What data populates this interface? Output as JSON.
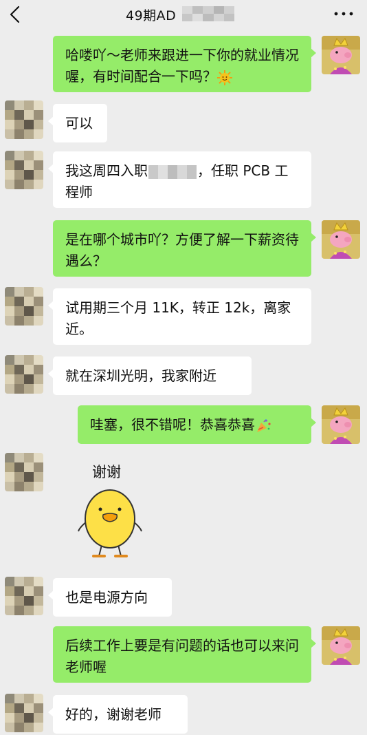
{
  "header": {
    "title_visible": "49期AD",
    "back_icon": "chevron-left-icon",
    "more_icon": "more-dots-icon"
  },
  "colors": {
    "my_bubble": "#95ec69",
    "other_bubble": "#ffffff",
    "background": "#ededed"
  },
  "messages": [
    {
      "sender": "me",
      "text": "哈喽吖～老师来跟进一下你的就业情况喔，有时间配合一下吗？",
      "emoji": "sun-face-emoji"
    },
    {
      "sender": "other",
      "text": "可以"
    },
    {
      "sender": "other",
      "text_before": "我这周四入职",
      "text_after": "，任职 PCB 工程师"
    },
    {
      "sender": "me",
      "text": "是在哪个城市吖？方便了解一下薪资待遇么？"
    },
    {
      "sender": "other",
      "text": "试用期三个月 11K，转正 12k，离家近。"
    },
    {
      "sender": "other",
      "text": "就在深圳光明，我家附近"
    },
    {
      "sender": "me",
      "text": "哇塞，很不错呢！恭喜恭喜",
      "emoji": "party-popper-emoji"
    },
    {
      "sender": "other",
      "sticker_caption": "谢谢",
      "sticker": "yellow-duck-sticker"
    },
    {
      "sender": "other",
      "text": "也是电源方向"
    },
    {
      "sender": "me",
      "text": "后续工作上要是有问题的话也可以来问老师喔"
    },
    {
      "sender": "other",
      "text": "好的，谢谢老师"
    }
  ]
}
